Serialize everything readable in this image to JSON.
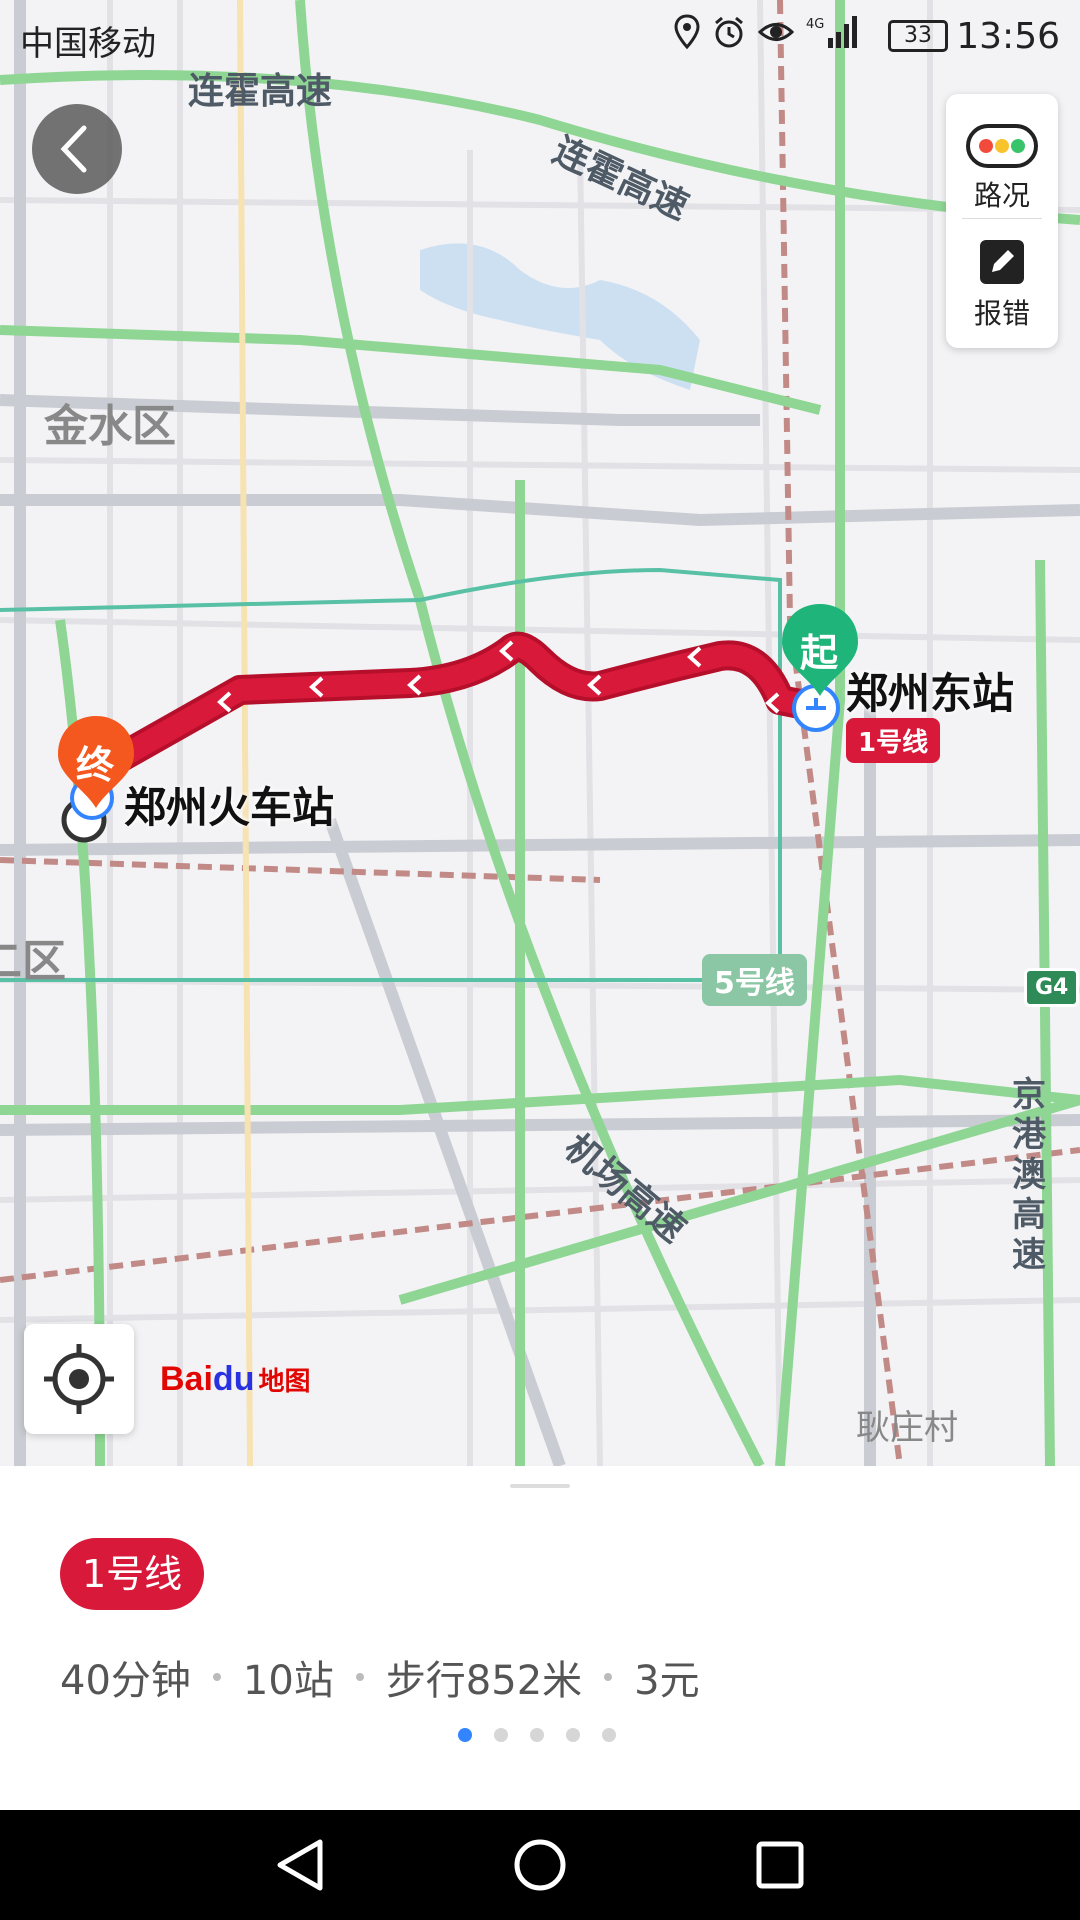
{
  "status_bar": {
    "carrier": "中国移动",
    "battery": "33",
    "time": "13:56",
    "icons": [
      "location-icon",
      "alarm-icon",
      "eye-icon",
      "signal-4g-icon"
    ]
  },
  "map": {
    "road_labels": [
      "连霍高速",
      "连霍高速",
      "机场高速",
      "京港澳高速"
    ],
    "area_labels": [
      "金水区",
      "二区",
      "耿庄村"
    ],
    "start_marker": "起",
    "end_marker": "终",
    "start_station": "郑州东站",
    "end_station": "郑州火车站",
    "route_badge": "1号线",
    "line5_badge": "5号线",
    "highway_badge": "G4",
    "route_color": "#d8193a",
    "start_color": "#1fb57a",
    "end_color": "#f5581f"
  },
  "right_panel": {
    "traffic_label": "路况",
    "report_label": "报错"
  },
  "logo": {
    "part1": "Bai",
    "part2": "du",
    "part3": "地图"
  },
  "route_card": {
    "line_label": "1号线",
    "duration": "40分钟",
    "stops": "10站",
    "walk": "步行852米",
    "fare": "3元",
    "page_count": 5,
    "active_page": 1
  },
  "navbar": {
    "buttons": [
      "back-triangle-icon",
      "home-circle-icon",
      "recents-square-icon"
    ]
  }
}
